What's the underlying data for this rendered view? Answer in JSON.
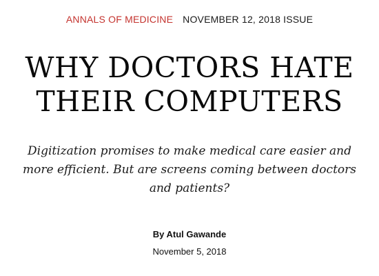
{
  "header": {
    "rubric": "ANNALS OF MEDICINE",
    "issue": "NOVEMBER 12, 2018 ISSUE"
  },
  "article": {
    "title_line1": "WHY DOCTORS HATE",
    "title_line2": "THEIR COMPUTERS",
    "dek": "Digitization promises to make medical care easier and more efficient. But are screens coming between doctors and patients?",
    "byline": "By Atul Gawande",
    "date": "November 5, 2018"
  },
  "colors": {
    "rubric": "#c4332e",
    "text": "#000000",
    "background": "#ffffff"
  }
}
